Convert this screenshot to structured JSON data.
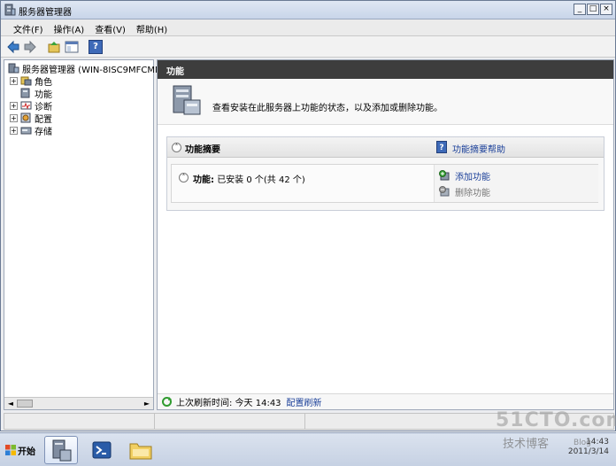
{
  "window": {
    "title": "服务器管理器",
    "min_label": "_",
    "max_label": "□",
    "close_label": "×"
  },
  "menu": [
    {
      "label": "文件(F)"
    },
    {
      "label": "操作(A)"
    },
    {
      "label": "查看(V)"
    },
    {
      "label": "帮助(H)"
    }
  ],
  "toolbar": {
    "icons": [
      "back-icon",
      "forward-icon",
      "up-folder-icon",
      "show-hide-tree-icon",
      "help-icon"
    ],
    "help_label": "?"
  },
  "tree": {
    "root": "服务器管理器 (WIN-8ISC9MFCMM",
    "items": [
      {
        "label": "角色",
        "expandable": true
      },
      {
        "label": "功能",
        "expandable": false
      },
      {
        "label": "诊断",
        "expandable": true
      },
      {
        "label": "配置",
        "expandable": true
      },
      {
        "label": "存储",
        "expandable": true
      }
    ],
    "expander_label": "+",
    "scroll_left": "◄",
    "scroll_right": "►"
  },
  "main": {
    "header": "功能",
    "description": "查看安装在此服务器上功能的状态，以及添加或删除功能。",
    "summary": {
      "title": "功能摘要",
      "collapse_label": "˄",
      "help_label": "?",
      "help_link": "功能摘要帮助",
      "features_label": "功能:",
      "features_status": "已安装 0 个(共 42 个)",
      "actions": [
        {
          "label": "添加功能",
          "enabled": true
        },
        {
          "label": "删除功能",
          "enabled": false
        }
      ]
    },
    "status": {
      "text": "上次刷新时间: 今天 14:43",
      "link": "配置刷新"
    }
  },
  "taskbar": {
    "start_label": "开始",
    "clock_time": "14:43",
    "clock_date": "2011/3/14"
  },
  "watermark": {
    "line1": "51CTO.com",
    "line2": "技术博客",
    "line3": "Blog"
  },
  "colors": {
    "header_bg": "#3d3d3d",
    "link": "#1a3f99",
    "title_bar": "#c8d5e9"
  }
}
